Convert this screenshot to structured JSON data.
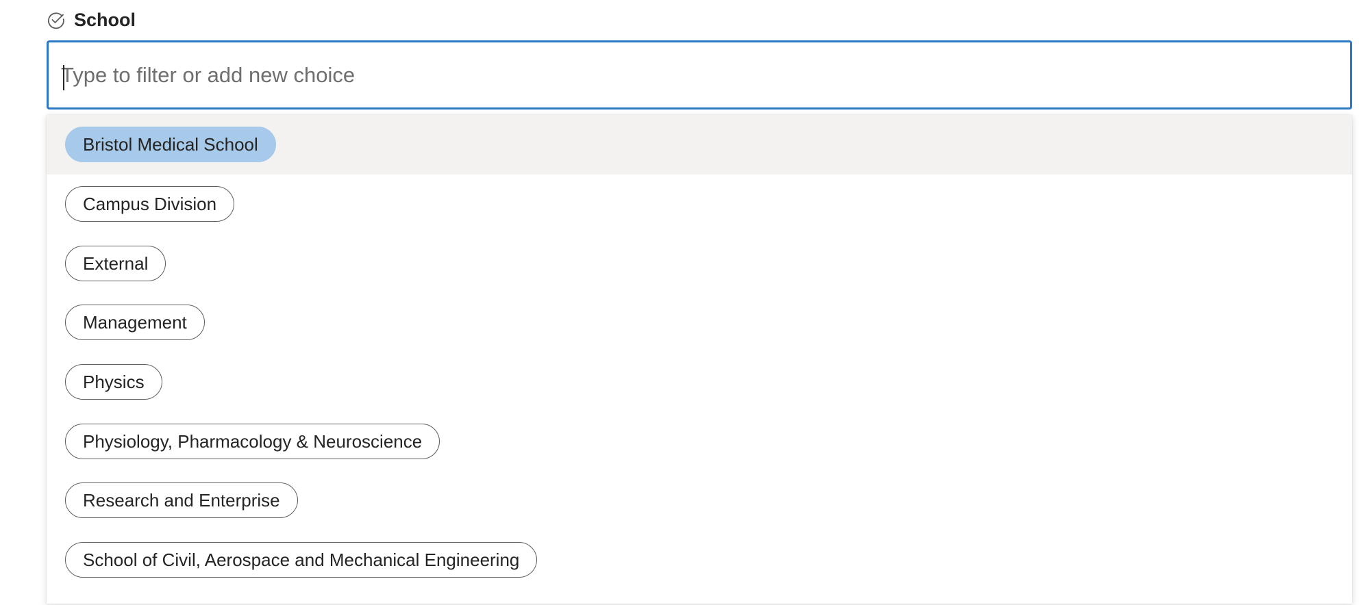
{
  "field": {
    "label": "School",
    "icon": "check-circle-icon"
  },
  "filter": {
    "placeholder": "Type to filter or add new choice",
    "value": ""
  },
  "options": [
    {
      "label": "Bristol Medical School",
      "highlighted": true
    },
    {
      "label": "Campus Division",
      "highlighted": false
    },
    {
      "label": "External",
      "highlighted": false
    },
    {
      "label": "Management",
      "highlighted": false
    },
    {
      "label": "Physics",
      "highlighted": false
    },
    {
      "label": "Physiology, Pharmacology & Neuroscience",
      "highlighted": false
    },
    {
      "label": "Research and Enterprise",
      "highlighted": false
    },
    {
      "label": "School of Civil, Aerospace and Mechanical Engineering",
      "highlighted": false
    }
  ],
  "colors": {
    "focus_border": "#2a78c6",
    "highlight_row": "#f3f2f1",
    "selected_chip": "#a7c9ea"
  }
}
